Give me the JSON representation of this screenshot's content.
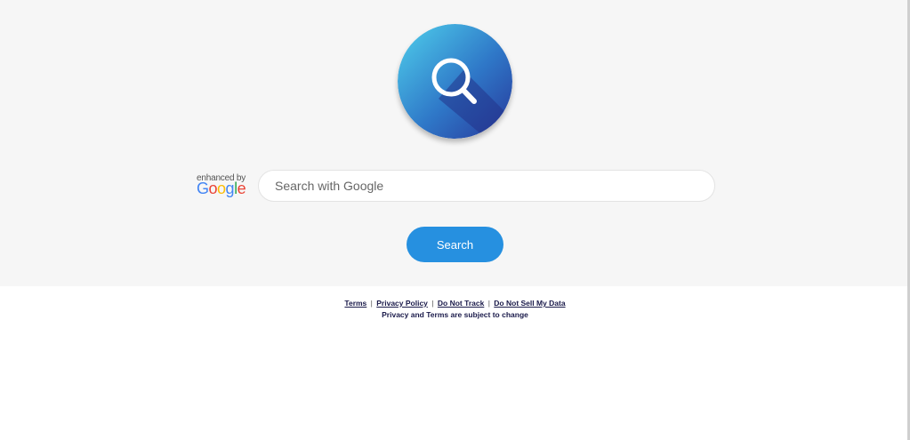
{
  "branding": {
    "logo_icon": "magnifier-icon",
    "enhanced_by": "enhanced by",
    "google_letters": [
      "G",
      "o",
      "o",
      "g",
      "l",
      "e"
    ],
    "colors": {
      "circle_light": "#4ac8e8",
      "circle_dark": "#2a3d9a",
      "google_blue": "#4285F4",
      "google_red": "#EA4335",
      "google_yellow": "#FBBC05",
      "google_green": "#34A853"
    }
  },
  "search": {
    "placeholder": "Search with Google",
    "value": "",
    "button_label": "Search",
    "button_color": "#2690e0"
  },
  "footer": {
    "links": {
      "terms": "Terms",
      "privacy_policy": "Privacy Policy",
      "do_not_track": "Do Not Track",
      "do_not_sell": "Do Not Sell My Data"
    },
    "separator": "|",
    "note_prefix": "Privacy and ",
    "note_link": "Terms",
    "note_suffix": " are subject to change"
  }
}
